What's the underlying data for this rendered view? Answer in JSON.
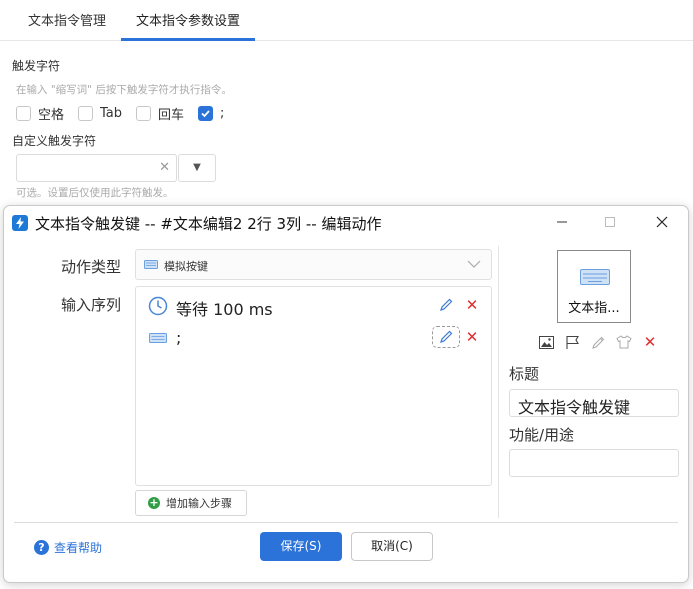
{
  "background": {
    "tabs": [
      {
        "label": "文本指令管理"
      },
      {
        "label": "文本指令参数设置"
      }
    ],
    "trigger_section": {
      "title": "触发字符",
      "hint": "在输入 \"缩写词\" 后按下触发字符才执行指令。",
      "options": [
        {
          "label": "空格",
          "checked": false
        },
        {
          "label": "Tab",
          "checked": false
        },
        {
          "label": "回车",
          "checked": false
        },
        {
          "label": ";",
          "checked": true
        }
      ]
    },
    "custom_section": {
      "title": "自定义触发字符",
      "input_value": "",
      "hint": "可选。设置后仅使用此字符触发。"
    }
  },
  "dialog": {
    "title": "文本指令触发键 -- #文本编辑2 2行 3列 -- 编辑动作",
    "action_type_label": "动作类型",
    "action_type_value": "模拟按键",
    "input_seq_label": "输入序列",
    "steps": [
      {
        "icon": "clock-icon",
        "text": "等待 100 ms"
      },
      {
        "icon": "keyboard-icon",
        "text": ";"
      }
    ],
    "add_step_label": "增加输入步骤",
    "preview_label": "文本指...",
    "title_label": "标题",
    "title_value": "文本指令触发键",
    "purpose_label": "功能/用途",
    "purpose_value": "",
    "help_label": "查看帮助",
    "save_label": "保存(S)",
    "cancel_label": "取消(C)"
  },
  "colors": {
    "accent": "#2b73d8",
    "danger": "#e03030",
    "success": "#2f9e44"
  }
}
